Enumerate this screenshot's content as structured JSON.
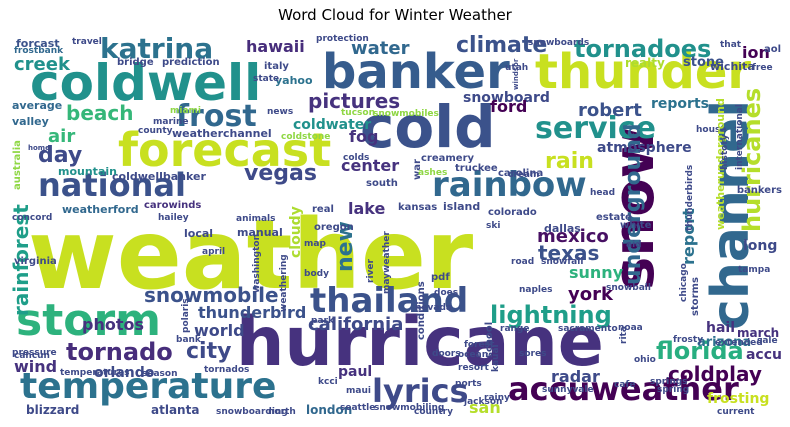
{
  "chart_data": {
    "type": "wordcloud",
    "title": "Word Cloud for Winter Weather",
    "background": "#ffffff",
    "colormap": "viridis",
    "words": [
      {
        "text": "weather",
        "color": "#c8e020"
      },
      {
        "text": "hurricane",
        "color": "#46327e"
      },
      {
        "text": "cold",
        "color": "#3b528b"
      },
      {
        "text": "coldwell",
        "color": "#21918c"
      },
      {
        "text": "banker",
        "color": "#365c8d"
      },
      {
        "text": "thunder",
        "color": "#c8e020"
      },
      {
        "text": "forecast",
        "color": "#c8e020"
      },
      {
        "text": "snow",
        "color": "#440154"
      },
      {
        "text": "channel",
        "color": "#31688e"
      },
      {
        "text": "storm",
        "color": "#2db27d"
      },
      {
        "text": "temperature",
        "color": "#2c728e"
      },
      {
        "text": "national",
        "color": "#3b528b"
      },
      {
        "text": "rainbow",
        "color": "#31688e"
      },
      {
        "text": "thailand",
        "color": "#3b528b"
      },
      {
        "text": "accuweather",
        "color": "#440154"
      },
      {
        "text": "lyrics",
        "color": "#3e4a89"
      },
      {
        "text": "service",
        "color": "#21918c"
      },
      {
        "text": "frost",
        "color": "#31688e"
      },
      {
        "text": "katrina",
        "color": "#2c728e"
      },
      {
        "text": "tornadoes",
        "color": "#21918c"
      },
      {
        "text": "hurricanes",
        "color": "#b5de2b"
      },
      {
        "text": "underground",
        "color": "#31688e"
      },
      {
        "text": "florida",
        "color": "#28ae80"
      },
      {
        "text": "lightning",
        "color": "#1f9e89"
      },
      {
        "text": "tornado",
        "color": "#472d7b"
      },
      {
        "text": "rain",
        "color": "#c8e020"
      },
      {
        "text": "snowmobile",
        "color": "#3b528b"
      },
      {
        "text": "rainforest",
        "color": "#1f9e89"
      },
      {
        "text": "climate",
        "color": "#3b528b"
      },
      {
        "text": "pictures",
        "color": "#46327e"
      },
      {
        "text": "vegas",
        "color": "#3e4a89"
      },
      {
        "text": "day",
        "color": "#3e4a89"
      },
      {
        "text": "new",
        "color": "#2c728e"
      },
      {
        "text": "texas",
        "color": "#3b528b"
      },
      {
        "text": "mexico",
        "color": "#471063"
      },
      {
        "text": "city",
        "color": "#3e4a89"
      },
      {
        "text": "california",
        "color": "#3e4a89"
      },
      {
        "text": "coldplay",
        "color": "#440154"
      },
      {
        "text": "water",
        "color": "#31688e"
      },
      {
        "text": "hawaii",
        "color": "#472d7b"
      },
      {
        "text": "beach",
        "color": "#35b779"
      },
      {
        "text": "creek",
        "color": "#21918c"
      },
      {
        "text": "air",
        "color": "#35b779"
      },
      {
        "text": "robert",
        "color": "#3b528b"
      },
      {
        "text": "report",
        "color": "#2c728e"
      },
      {
        "text": "center",
        "color": "#46327e"
      },
      {
        "text": "radar",
        "color": "#3e4a89"
      },
      {
        "text": "sunny",
        "color": "#2db27d"
      },
      {
        "text": "york",
        "color": "#440154"
      },
      {
        "text": "thunderbird",
        "color": "#3b528b"
      },
      {
        "text": "photos",
        "color": "#46327e"
      },
      {
        "text": "world",
        "color": "#3e4a89"
      },
      {
        "text": "wind",
        "color": "#46327e"
      },
      {
        "text": "atmosphere",
        "color": "#3e4a89"
      },
      {
        "text": "reports",
        "color": "#2c728e"
      },
      {
        "text": "snowboard",
        "color": "#3e4a89"
      },
      {
        "text": "coldwater",
        "color": "#21918c"
      },
      {
        "text": "lake",
        "color": "#46327e"
      },
      {
        "text": "ion",
        "color": "#440154"
      },
      {
        "text": "ford",
        "color": "#440154"
      },
      {
        "text": "fog",
        "color": "#46327e"
      },
      {
        "text": "cloudy",
        "color": "#addc30"
      },
      {
        "text": "san",
        "color": "#b5de2b"
      },
      {
        "text": "paul",
        "color": "#46327e"
      },
      {
        "text": "orlando",
        "color": "#3e4a89"
      },
      {
        "text": "atlanta",
        "color": "#3e4a89"
      },
      {
        "text": "blizzard",
        "color": "#3e4a89"
      },
      {
        "text": "london",
        "color": "#31688e"
      },
      {
        "text": "hail",
        "color": "#46327e"
      },
      {
        "text": "arizona",
        "color": "#2c728e"
      },
      {
        "text": "accu",
        "color": "#46327e"
      },
      {
        "text": "march",
        "color": "#46327e"
      },
      {
        "text": "long",
        "color": "#3e4a89"
      },
      {
        "text": "frosting",
        "color": "#c8e020"
      },
      {
        "text": "stone",
        "color": "#3b528b"
      },
      {
        "text": "realty",
        "color": "#addc30"
      },
      {
        "text": "forcast",
        "color": "#3b528b"
      },
      {
        "text": "weatherford",
        "color": "#31688e"
      },
      {
        "text": "coldwellbanker",
        "color": "#3e4a89"
      },
      {
        "text": "weatherchannel",
        "color": "#3e4a89"
      },
      {
        "text": "mountain",
        "color": "#21918c"
      },
      {
        "text": "valley",
        "color": "#31688e"
      },
      {
        "text": "average",
        "color": "#31688e"
      },
      {
        "text": "australia",
        "color": "#8fd744"
      },
      {
        "text": "virginia",
        "color": "#3e4a89"
      },
      {
        "text": "local",
        "color": "#3e4a89"
      },
      {
        "text": "manual",
        "color": "#3e4a89"
      },
      {
        "text": "carowinds",
        "color": "#46327e"
      },
      {
        "text": "yahoo",
        "color": "#2c728e"
      },
      {
        "text": "italy",
        "color": "#3e4a89"
      },
      {
        "text": "prediction",
        "color": "#3e4a89"
      },
      {
        "text": "bridge",
        "color": "#3e4a89"
      },
      {
        "text": "frostbank",
        "color": "#31688e"
      },
      {
        "text": "travel",
        "color": "#3e4a89"
      },
      {
        "text": "protection",
        "color": "#3e4a89"
      },
      {
        "text": "snowboards",
        "color": "#3e4a89"
      },
      {
        "text": "wichita",
        "color": "#3e4a89"
      },
      {
        "text": "aol",
        "color": "#3e4a89"
      },
      {
        "text": "that",
        "color": "#3e4a89"
      },
      {
        "text": "free",
        "color": "#3e4a89"
      },
      {
        "text": "utah",
        "color": "#3e4a89"
      },
      {
        "text": "state",
        "color": "#3e4a89"
      },
      {
        "text": "news",
        "color": "#3e4a89"
      },
      {
        "text": "miami",
        "color": "#8fd744"
      },
      {
        "text": "marine",
        "color": "#3e4a89"
      },
      {
        "text": "county",
        "color": "#3e4a89"
      },
      {
        "text": "tucson",
        "color": "#8fd744"
      },
      {
        "text": "snowmobiles",
        "color": "#8fd744"
      },
      {
        "text": "coldstone",
        "color": "#8fd744"
      },
      {
        "text": "colds",
        "color": "#3e4a89"
      },
      {
        "text": "creamery",
        "color": "#3e4a89"
      },
      {
        "text": "truckee",
        "color": "#3e4a89"
      },
      {
        "text": "cream",
        "color": "#3e4a89"
      },
      {
        "text": "carolina",
        "color": "#3e4a89"
      },
      {
        "text": "south",
        "color": "#3e4a89"
      },
      {
        "text": "war",
        "color": "#3e4a89"
      },
      {
        "text": "ashes",
        "color": "#8fd744"
      },
      {
        "text": "white",
        "color": "#3e4a89"
      },
      {
        "text": "house",
        "color": "#3e4a89"
      },
      {
        "text": "head",
        "color": "#3e4a89"
      },
      {
        "text": "weatherunderground",
        "color": "#b5de2b"
      },
      {
        "text": "international",
        "color": "#3e4a89"
      },
      {
        "text": "history",
        "color": "#3e4a89"
      },
      {
        "text": "thunderbirds",
        "color": "#3e4a89"
      },
      {
        "text": "chicago",
        "color": "#3e4a89"
      },
      {
        "text": "storms",
        "color": "#3e4a89"
      },
      {
        "text": "bankers",
        "color": "#3e4a89"
      },
      {
        "text": "estate",
        "color": "#3e4a89"
      },
      {
        "text": "dallas",
        "color": "#3e4a89"
      },
      {
        "text": "colorado",
        "color": "#3e4a89"
      },
      {
        "text": "kansas",
        "color": "#3e4a89"
      },
      {
        "text": "island",
        "color": "#3e4a89"
      },
      {
        "text": "oregon",
        "color": "#3e4a89"
      },
      {
        "text": "real",
        "color": "#3e4a89"
      },
      {
        "text": "animals",
        "color": "#3e4a89"
      },
      {
        "text": "ski",
        "color": "#3e4a89"
      },
      {
        "text": "aid",
        "color": "#3e4a89"
      },
      {
        "text": "concord",
        "color": "#3e4a89"
      },
      {
        "text": "hailey",
        "color": "#3e4a89"
      },
      {
        "text": "april",
        "color": "#3e4a89"
      },
      {
        "text": "washington",
        "color": "#3e4a89"
      },
      {
        "text": "weathering",
        "color": "#3e4a89"
      },
      {
        "text": "map",
        "color": "#3e4a89"
      },
      {
        "text": "body",
        "color": "#3e4a89"
      },
      {
        "text": "river",
        "color": "#3e4a89"
      },
      {
        "text": "mayweather",
        "color": "#3e4a89"
      },
      {
        "text": "pdf",
        "color": "#3e4a89"
      },
      {
        "text": "does",
        "color": "#3e4a89"
      },
      {
        "text": "road",
        "color": "#3e4a89"
      },
      {
        "text": "snowfall",
        "color": "#3e4a89"
      },
      {
        "text": "snowball",
        "color": "#3e4a89"
      },
      {
        "text": "tampa",
        "color": "#3e4a89"
      },
      {
        "text": "conditions",
        "color": "#3e4a89"
      },
      {
        "text": "school",
        "color": "#3e4a89"
      },
      {
        "text": "nevada",
        "color": "#3e4a89"
      },
      {
        "text": "naples",
        "color": "#3e4a89"
      },
      {
        "text": "noaa",
        "color": "#3e4a89"
      },
      {
        "text": "extended",
        "color": "#3e4a89"
      },
      {
        "text": "sale",
        "color": "#3e4a89"
      },
      {
        "text": "pressure",
        "color": "#3e4a89"
      },
      {
        "text": "polaris",
        "color": "#3e4a89"
      },
      {
        "text": "bank",
        "color": "#3e4a89"
      },
      {
        "text": "park",
        "color": "#3e4a89"
      },
      {
        "text": "range",
        "color": "#3e4a89"
      },
      {
        "text": "sacramento",
        "color": "#3e4a89"
      },
      {
        "text": "rita",
        "color": "#3e4a89"
      },
      {
        "text": "frosty",
        "color": "#3e4a89"
      },
      {
        "text": "cancun",
        "color": "#3e4a89"
      },
      {
        "text": "temperatures",
        "color": "#3e4a89"
      },
      {
        "text": "season",
        "color": "#3e4a89"
      },
      {
        "text": "tornados",
        "color": "#3e4a89"
      },
      {
        "text": "doors",
        "color": "#3e4a89"
      },
      {
        "text": "forest",
        "color": "#3e4a89"
      },
      {
        "text": "ocean",
        "color": "#3e4a89"
      },
      {
        "text": "sores",
        "color": "#3e4a89"
      },
      {
        "text": "kauai",
        "color": "#3e4a89"
      },
      {
        "text": "ohio",
        "color": "#3e4a89"
      },
      {
        "text": "resort",
        "color": "#3e4a89"
      },
      {
        "text": "kcci",
        "color": "#3e4a89"
      },
      {
        "text": "maui",
        "color": "#3e4a89"
      },
      {
        "text": "seattle",
        "color": "#3e4a89"
      },
      {
        "text": "snowmobiling",
        "color": "#3e4a89"
      },
      {
        "text": "sunnyvale",
        "color": "#3e4a89"
      },
      {
        "text": "cafe",
        "color": "#3e4a89"
      },
      {
        "text": "springs",
        "color": "#3e4a89"
      },
      {
        "text": "spring",
        "color": "#3e4a89"
      },
      {
        "text": "ports",
        "color": "#3e4a89"
      },
      {
        "text": "rainy",
        "color": "#3e4a89"
      },
      {
        "text": "jackson",
        "color": "#3e4a89"
      },
      {
        "text": "country",
        "color": "#3e4a89"
      },
      {
        "text": "north",
        "color": "#3e4a89"
      },
      {
        "text": "snowboarding",
        "color": "#3e4a89"
      },
      {
        "text": "current",
        "color": "#3e4a89"
      },
      {
        "text": "home",
        "color": "#3e4a89"
      },
      {
        "text": "windsor",
        "color": "#3e4a89"
      }
    ]
  }
}
